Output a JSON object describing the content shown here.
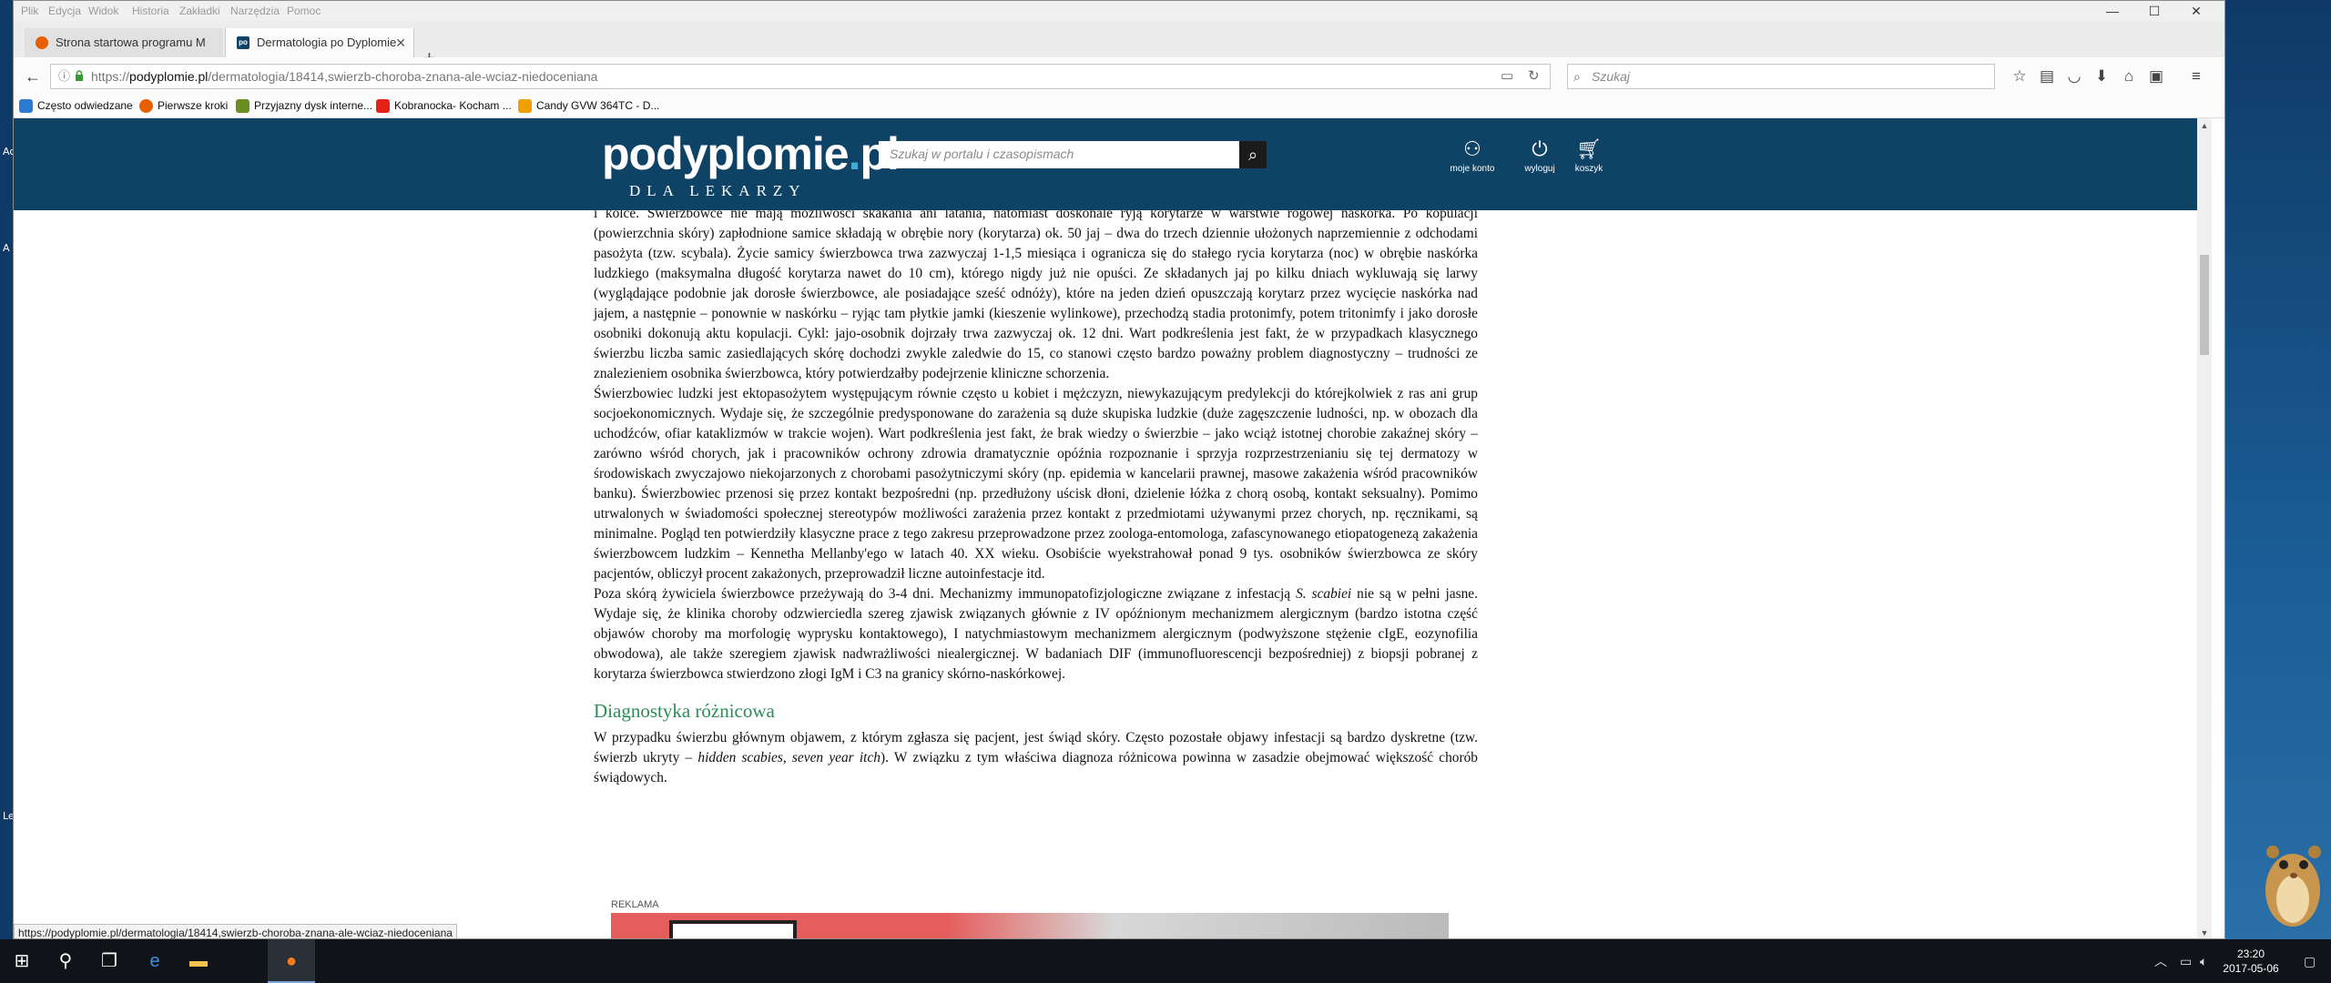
{
  "desktop": {
    "left_labels": [
      "Ac",
      "A",
      "Le"
    ]
  },
  "menubar": {
    "items": [
      "Plik",
      "Edycja",
      "Widok",
      "Historia",
      "Zakładki",
      "Narzędzia",
      "Pomoc"
    ]
  },
  "window_controls": {
    "minimize": "—",
    "maximize": "☐",
    "close": "✕"
  },
  "tabs": [
    {
      "title": "Strona startowa programu M",
      "icon": "firefox-icon",
      "color": "#e66000"
    },
    {
      "title": "Dermatologia po Dyplomie",
      "icon": "po-site-icon",
      "color": "#0f4366"
    }
  ],
  "tab_close": "✕",
  "new_tab": "+",
  "nav": {
    "back": "←",
    "url_prefix": "https://",
    "url_domain": "podyplomie.pl",
    "url_path": "/dermatologia/18414,swierzb-choroba-znana-ale-wciaz-niedoceniana",
    "search_placeholder": "Szukaj"
  },
  "bookmarks": [
    {
      "label": "Często odwiedzane",
      "color": "#2b7bd3"
    },
    {
      "label": "Pierwsze kroki",
      "color": "#e66000"
    },
    {
      "label": "Przyjazny dysk interne...",
      "color": "#6b8e23"
    },
    {
      "label": "Kobranocka- Kocham ...",
      "color": "#e62117"
    },
    {
      "label": "Candy GVW 364TC - D...",
      "color": "#f0a000"
    }
  ],
  "site": {
    "logo_main": "podyplomie",
    "logo_dot": ".",
    "logo_tld": "pl",
    "logo_sub": "DLA LEKARZY",
    "search_placeholder": "Szukaj w portalu i czasopismach",
    "account_label": "moje konto",
    "logout_label": "wyloguj",
    "cart_label": "koszyk"
  },
  "article": {
    "p1": "i kolce. Świerzbowce nie mają możliwości skakania ani latania, natomiast doskonale ryją korytarze w warstwie rogowej naskórka. Po kopulacji (powierzchnia skóry) zapłodnione samice składają w obrębie nory (korytarza) ok. 50 jaj – dwa do trzech dziennie ułożonych naprzemiennie z odchodami pasożyta (tzw. scybala). Życie samicy świerzbowca trwa zazwyczaj 1-1,5 miesiąca i ogranicza się do stałego rycia korytarza (noc) w obrębie naskórka ludzkiego (maksymalna długość korytarza nawet do 10 cm), którego nigdy już nie opuści. Ze składanych jaj po kilku dniach wykluwają się larwy (wyglądające podobnie jak dorosłe świerzbowce, ale posiadające sześć odnóży), które na jeden dzień opuszczają korytarz przez wycięcie naskórka nad jajem, a następnie – ponownie w naskórku – ryjąc tam płytkie jamki (kieszenie wylinkowe), przechodzą stadia protonimfy, potem tritonimfy i jako dorosłe osobniki dokonują aktu kopulacji. Cykl: jajo-osobnik dojrzały trwa zazwyczaj ok. 12 dni. Wart podkreślenia jest fakt, że w przypadkach klasycznego świerzbu liczba samic zasiedlających skórę dochodzi zwykle zaledwie do 15, co stanowi często bardzo poważny problem diagnostyczny – trudności ze znalezieniem osobnika świerzbowca, który potwierdzałby podejrzenie kliniczne schorzenia.",
    "p2": "Świerzbowiec ludzki jest ektopasożytem występującym równie często u kobiet i mężczyzn, niewykazującym predylekcji do którejkolwiek z ras ani grup socjoekonomicznych. Wydaje się, że szczególnie predysponowane do zarażenia są duże skupiska ludzkie (duże zagęszczenie ludności, np. w obozach dla uchodźców, ofiar kataklizmów w trakcie wojen). Wart podkreślenia jest fakt, że brak wiedzy o świerzbie – jako wciąż istotnej chorobie zakaźnej skóry – zarówno wśród chorych, jak i pracowników ochrony zdrowia dramatycznie opóźnia rozpoznanie i sprzyja rozprzestrzenianiu się tej dermatozy w środowiskach zwyczajowo niekojarzonych z chorobami pasożytniczymi skóry (np. epidemia w kancelarii prawnej, masowe zakażenia wśród pracowników banku). Świerzbowiec przenosi się przez kontakt bezpośredni (np. przedłużony uścisk dłoni, dzielenie łóżka z chorą osobą, kontakt seksualny). Pomimo utrwalonych w świadomości społecznej stereotypów możliwości zarażenia przez kontakt z przedmiotami używanymi przez chorych, np. ręcznikami, są minimalne. Pogląd ten potwierdziły klasyczne prace z tego zakresu przeprowadzone przez zoologa-entomologa, zafascynowanego etiopatogenezą zakażenia świerzbowcem ludzkim – Kennetha Mellanby'ego w latach 40. XX wieku. Osobiście wyekstrahował ponad 9 tys. osobników świerzbowca ze skóry pacjentów, obliczył procent zakażonych, przeprowadził liczne autoinfestacje itd.",
    "p3_before": "Poza skórą żywiciela świerzbowce przeżywają do 3-4 dni. Mechanizmy immunopatofizjologiczne związane z infestacją ",
    "p3_italic": "S. scabiei",
    "p3_after": " nie są w pełni jasne. Wydaje się, że klinika choroby odzwierciedla szereg zjawisk związanych głównie z IV opóźnionym mechanizmem alergicznym (bardzo istotna część objawów choroby ma morfologię wyprysku kontaktowego), I natychmiastowym mechanizmem alergicznym (podwyższone stężenie cIgE, eozynofilia obwodowa), ale także szeregiem zjawisk nadwrażliwości niealergicznej. W badaniach DIF (immunofluorescencji bezpośredniej) z biopsji pobranej z korytarza świerzbowca stwierdzono złogi IgM i C3 na granicy skórno-naskórkowej.",
    "h2": "Diagnostyka różnicowa",
    "p4_before": "W przypadku świerzbu głównym objawem, z którym zgłasza się pacjent, jest świąd skóry. Często pozostałe objawy infestacji są bardzo dyskretne (tzw. świerzb ukryty – ",
    "p4_italic": "hidden scabies, seven year itch",
    "p4_after": "). W związku z tym właściwa diagnoza różnicowa powinna w zasadzie obejmować większość chorób świądowych.",
    "ad_label": "REKLAMA"
  },
  "status_url": "https://podyplomie.pl/dermatologia/18414,swierzb-choroba-znana-ale-wciaz-niedoceniana",
  "taskbar": {
    "time": "23:20",
    "date": "2017-05-06"
  }
}
